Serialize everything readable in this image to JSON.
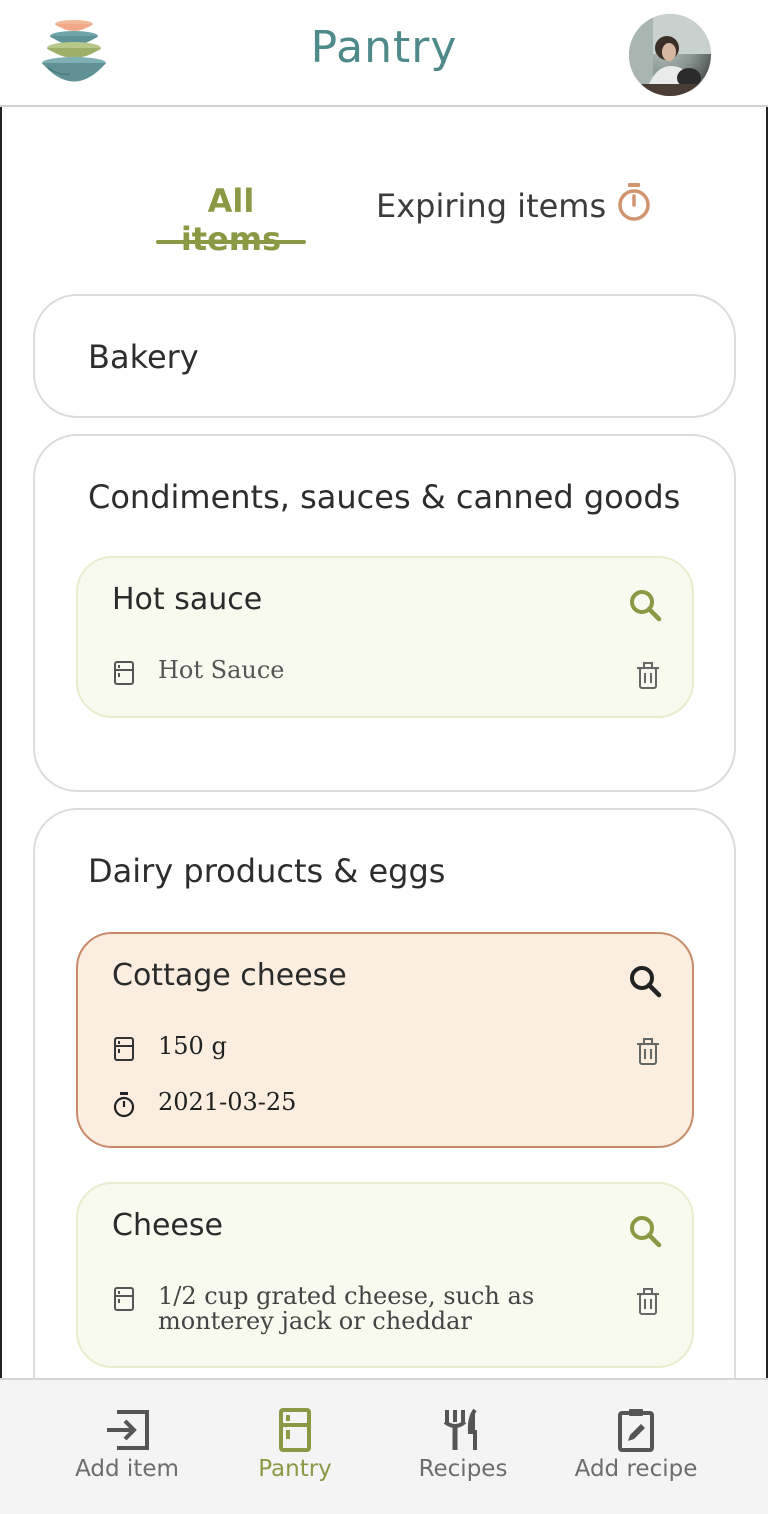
{
  "app": {
    "title": "Pantry"
  },
  "tabs": {
    "all": "All items",
    "expiring": "Expiring items"
  },
  "categories": [
    {
      "title": "Bakery",
      "items": []
    },
    {
      "title": "Condiments, sauces & canned goods",
      "items": [
        {
          "name": "Hot sauce",
          "quantity": "Hot Sauce",
          "expiring": false
        }
      ]
    },
    {
      "title": "Dairy products & eggs",
      "items": [
        {
          "name": "Cottage cheese",
          "quantity": "150 g",
          "expiry_date": "2021-03-25",
          "expiring": true
        },
        {
          "name": "Cheese",
          "quantity": "1/2 cup grated cheese, such as monterey jack or cheddar",
          "expiring": false
        }
      ]
    }
  ],
  "bottom_nav": {
    "add_item": "Add item",
    "pantry": "Pantry",
    "recipes": "Recipes",
    "add_recipe": "Add recipe",
    "active": "pantry"
  },
  "colors": {
    "accent_green": "#8a9a44",
    "title_teal": "#4f8a8b",
    "expiring_bg": "#fbede0",
    "expiring_border": "#c98c6a",
    "timer_orange": "#d0956e"
  }
}
